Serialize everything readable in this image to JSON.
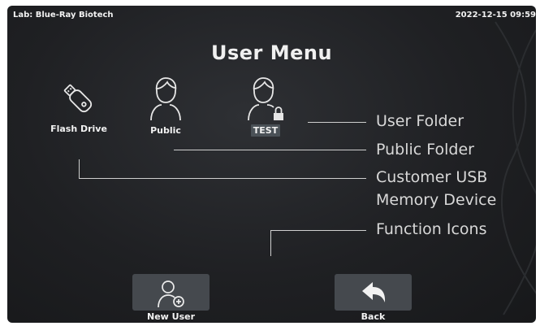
{
  "status": {
    "lab": "Lab: Blue-Ray Biotech",
    "datetime": "2022-12-15 09:59"
  },
  "title": "User Menu",
  "folders": [
    {
      "label": "Flash Drive",
      "icon": "usb-drive-icon"
    },
    {
      "label": "Public",
      "icon": "user-icon"
    },
    {
      "label": "TEST",
      "icon": "locked-user-icon"
    }
  ],
  "callouts": {
    "user_folder": "User Folder",
    "public_folder": "Public Folder",
    "usb_line1": "Customer USB",
    "usb_line2": "Memory Device",
    "function_icons": "Function Icons"
  },
  "buttons": {
    "new_user": {
      "label": "New User",
      "icon": "add-user-icon"
    },
    "back": {
      "label": "Back",
      "icon": "back-arrow-icon"
    }
  },
  "colors": {
    "screen_bg": "#1f2023",
    "button_bg": "#45494e",
    "highlight_bg": "#4a5157",
    "text": "#f2f2f2"
  }
}
